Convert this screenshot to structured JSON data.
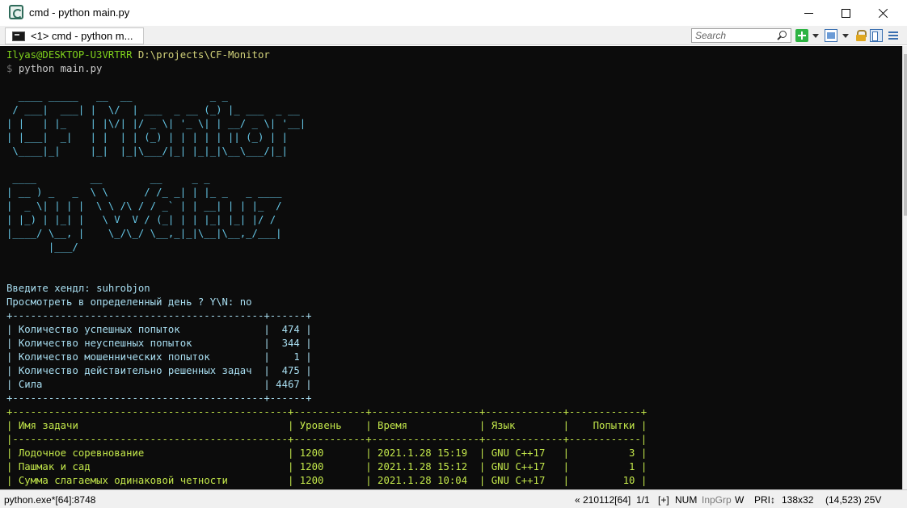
{
  "window": {
    "title": "cmd - python  main.py"
  },
  "tabbar": {
    "tab_label": "<1> cmd - python  m...",
    "search_placeholder": "Search"
  },
  "console": {
    "prompt_user": "Ilyas@DESKTOP-U3VRTRR",
    "prompt_path": "D:\\projects\\CF-Monitor",
    "prompt_symbol": "$",
    "command": "python main.py",
    "banner_line_1": "  ____ _____   __  __             _ _",
    "banner_line_2": " / ___|  ___| |  \\/  | ___  _ __ (_) |_ ___  _ __",
    "banner_line_3": "| |   | |_    | |\\/| |/ _ \\| '_ \\| | __/ _ \\| '__|",
    "banner_line_4": "| |___|  _|   | |  | | (_) | | | | | || (_) | |",
    "banner_line_5": " \\____|_|     |_|  |_|\\___/|_| |_|_|\\__\\___/|_|",
    "banner_line_6": " ____         __        __     _ _",
    "banner_line_7": "| __ ) _   _  \\ \\      / /_ _| | |_ _   _ ____",
    "banner_line_8": "|  _ \\| | | |  \\ \\ /\\ / / _` | | __| | | |_  /",
    "banner_line_9": "| |_) | |_| |   \\ V  V / (_| | | |_| |_| |/ /",
    "banner_line_10": "|____/ \\__, |    \\_/\\_/ \\__,_|_|\\__|\\__,_/___|",
    "banner_line_11": "       |___/",
    "handle_prompt": "Введите хендл: ",
    "handle_value": "suhrobjon",
    "day_prompt": "Просмотреть в определенный день ? Y\\N: ",
    "day_value": "no"
  },
  "stats_table": {
    "border": "+------------------------------------------+------+",
    "rows": [
      {
        "label": "Количество успешных попыток",
        "value": "474"
      },
      {
        "label": "Количество неуспешных попыток",
        "value": "344"
      },
      {
        "label": "Количество мошеннических попыток",
        "value": "1"
      },
      {
        "label": "Количество действительно решенных задач",
        "value": "475"
      },
      {
        "label": "Сила",
        "value": "4467"
      }
    ]
  },
  "tasks_table": {
    "border_top": "+----------------------------------------------+------------+------------------+-------------+------------+",
    "border_mid": "|----------------------------------------------+------------+------------------+-------------+------------|",
    "headers": [
      "Имя задачи",
      "Уровень",
      "Время",
      "Язык",
      "Попытки"
    ],
    "rows": [
      [
        "Лодочное соревнование",
        "1200",
        "2021.1.28 15:19",
        "GNU C++17",
        "3"
      ],
      [
        "Пашмак и сад",
        "1200",
        "2021.1.28 15:12",
        "GNU C++17",
        "1"
      ],
      [
        "Сумма слагаемых одинаковой четности",
        "1200",
        "2021.1.28 10:04",
        "GNU C++17",
        "10"
      ]
    ]
  },
  "statusbar": {
    "process": "python.exe*[64]:8748",
    "position_info": "« 210112[64]",
    "page": "1/1",
    "plus": "[+]",
    "num": "NUM",
    "inpgrp": "InpGrp",
    "w": "W",
    "pri": "PRI↕",
    "size": "138x32",
    "coords": "(14,523) 25V"
  },
  "colors": {
    "console_bg": "#0c0c0c",
    "prompt_green": "#7fd11c",
    "path_yellow": "#d2d27a",
    "ascii_cyan": "#66c8e8",
    "table_lime": "#c2e64a"
  }
}
